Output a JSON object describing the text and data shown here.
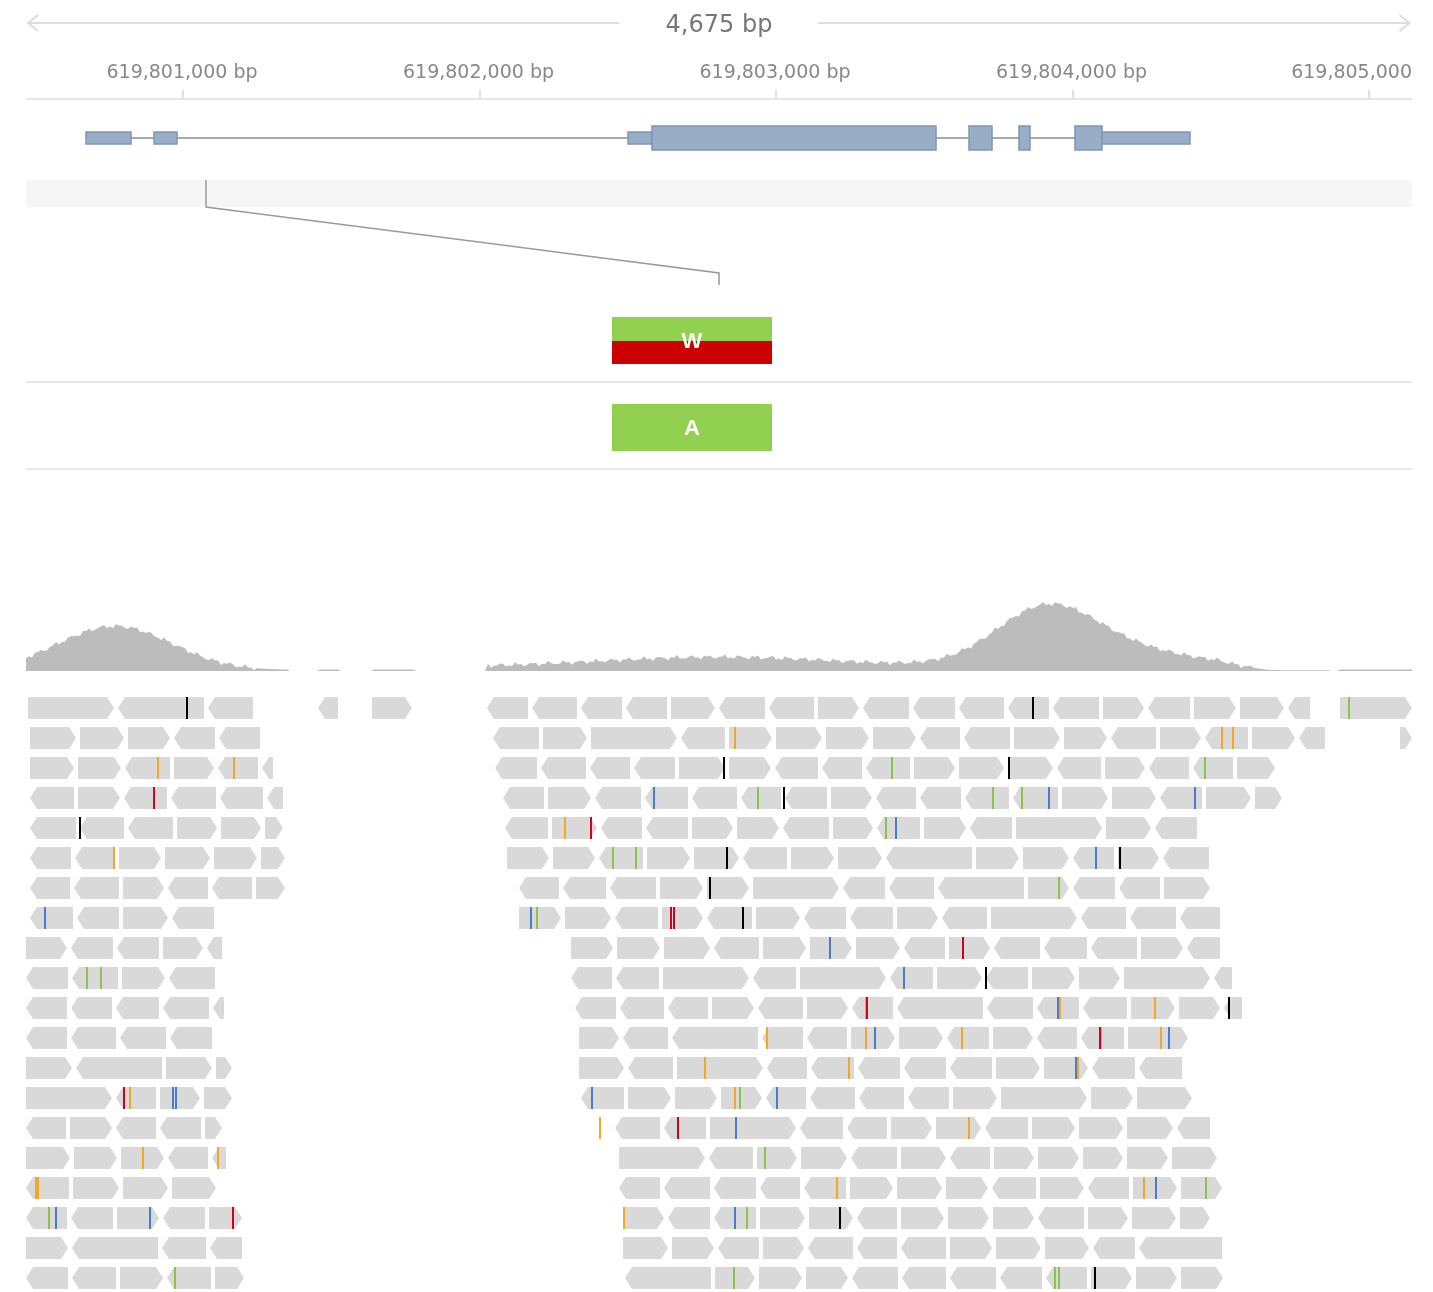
{
  "span": {
    "label": "4,675 bp"
  },
  "axis": {
    "ticks": [
      "619,801,000 bp",
      "619,802,000 bp",
      "619,803,000 bp",
      "619,804,000 bp",
      "619,805,000"
    ]
  },
  "variants": [
    {
      "label": "W",
      "alleles": [
        {
          "color": "#92d050"
        },
        {
          "color": "#cc0000"
        }
      ]
    },
    {
      "label": "A",
      "alleles": [
        {
          "color": "#92d050"
        }
      ]
    }
  ]
}
